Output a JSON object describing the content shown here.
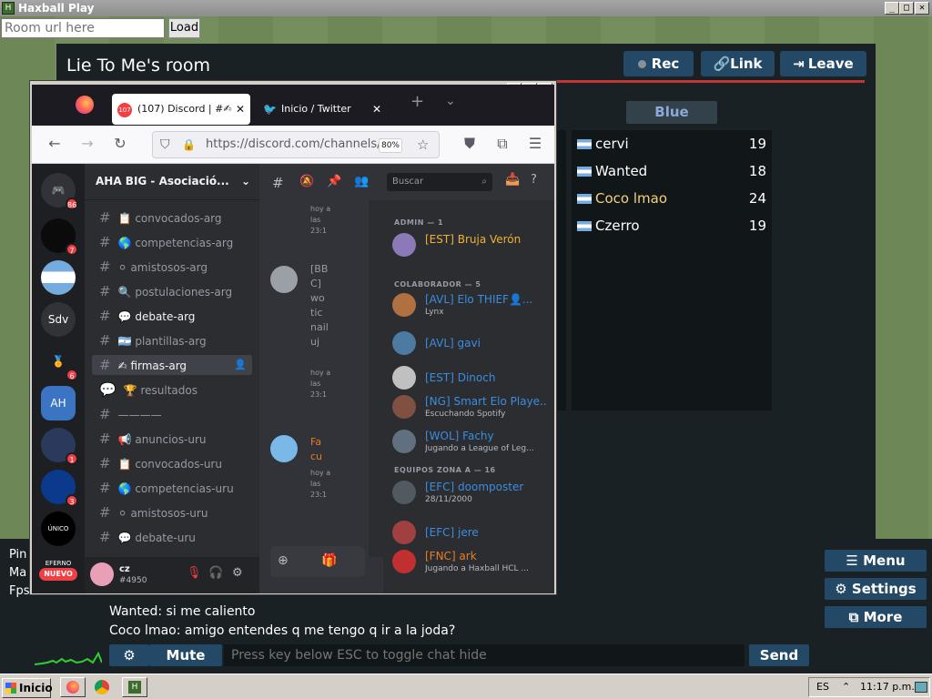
{
  "window": {
    "title": "Haxball Play",
    "icon": "H"
  },
  "toolbar": {
    "url_placeholder": "Room url here",
    "load_label": "Load"
  },
  "room": {
    "title": "Lie To Me's room",
    "rec_label": "Rec",
    "link_label": "Link",
    "leave_label": "Leave",
    "blue_team_label": "Blue",
    "blue_players": [
      {
        "name": "cervi",
        "score": "19",
        "flag": "argentina-flag"
      },
      {
        "name": "Wanted",
        "score": "18",
        "flag": "argentina-flag"
      },
      {
        "name": "Coco lmao",
        "score": "24",
        "flag": "argentina-flag",
        "highlight": "#f5d17e"
      },
      {
        "name": "Czerro",
        "score": "19",
        "flag": "argentina-flag"
      }
    ]
  },
  "stats": {
    "ping_label": "Pin",
    "max_label": "Ma",
    "fps_label": "Fps: 85"
  },
  "chat": {
    "lines": [
      "Wanted: si me caliento",
      "Coco lmao: amigo entendes q me tengo q ir a la joda?"
    ],
    "mute_label": "Mute",
    "input_placeholder": "Press key below ESC to toggle chat hide",
    "send_label": "Send"
  },
  "side_menu": {
    "menu_label": "Menu",
    "settings_label": "Settings",
    "more_label": "More"
  },
  "firefox": {
    "tabs": [
      {
        "label": "(107) Discord | #✍",
        "active": true,
        "badge": "107"
      },
      {
        "label": "Inicio / Twitter",
        "active": false
      }
    ],
    "url": "https://discord.com/channels/",
    "zoom": "80%"
  },
  "discord": {
    "guild_name": "AHA BIG - Asociació...",
    "servers": [
      {
        "label": "",
        "badge": "86"
      },
      {
        "label": "",
        "badge": "7"
      },
      {
        "label": "",
        "badge": ""
      },
      {
        "label": "Sdv",
        "badge": ""
      },
      {
        "label": "",
        "badge": "6"
      },
      {
        "label": "",
        "badge": ""
      },
      {
        "label": "",
        "badge": "1"
      },
      {
        "label": "",
        "badge": "3"
      },
      {
        "label": "ÚNICO EFERNO",
        "badge": ""
      },
      {
        "label": "",
        "badge": ""
      }
    ],
    "nuevo_label": "NUEVO",
    "channels": [
      {
        "label": "📋 convocados-arg"
      },
      {
        "label": "🌎 competencias-arg"
      },
      {
        "label": "⚪ amistosos-arg"
      },
      {
        "label": "🔍 postulaciones-arg"
      },
      {
        "label": "💬 debate-arg",
        "unread": true
      },
      {
        "label": "🇦🇷 plantillas-arg"
      },
      {
        "label": "✍ firmas-arg",
        "active": true
      },
      {
        "label": "🏆 resultados"
      },
      {
        "label": "————"
      },
      {
        "label": "📢 anuncios-uru"
      },
      {
        "label": "📋 convocados-uru"
      },
      {
        "label": "🌎 competencias-uru"
      },
      {
        "label": "⚪ amistosos-uru"
      },
      {
        "label": "💬 debate-uru"
      }
    ],
    "user": {
      "name": "cz",
      "tag": "#4950"
    },
    "search_placeholder": "Buscar",
    "messages": [
      {
        "text": "hoy a las 23:1"
      },
      {
        "text": "[BB C] wo tic nail uj",
        "time": "hoy a las 23:1"
      },
      {
        "text": "Fa cu",
        "time": "hoy a las 23:1"
      }
    ],
    "members": {
      "admin_header": "ADMIN — 1",
      "colab_header": "COLABORADOR — 5",
      "zona_header": "EQUIPOS ZONA A — 16",
      "list": [
        {
          "name": "[EST] Bruja Verón",
          "status": "",
          "color": "#f0b232"
        },
        {
          "name": "[AVL] Elo THIEF👤...",
          "status": "Lynx",
          "color": "#3b8de0"
        },
        {
          "name": "[AVL] gavi",
          "status": "",
          "color": "#3b8de0"
        },
        {
          "name": "[EST] Dinoch",
          "status": "",
          "color": "#3b8de0"
        },
        {
          "name": "[NG] Smart Elo Playe...",
          "status": "Escuchando Spotify",
          "color": "#3b8de0"
        },
        {
          "name": "[WOL] Fachy",
          "status": "Jugando a League of Leg...",
          "color": "#3b8de0"
        },
        {
          "name": "[EFC] doomposter",
          "status": "28/11/2000",
          "color": "#3b8de0"
        },
        {
          "name": "[EFC] jere",
          "status": "",
          "color": "#3b8de0"
        },
        {
          "name": "[FNC] ark",
          "status": "Jugando a Haxball HCL ...",
          "color": "#e67e22"
        }
      ]
    }
  },
  "taskbar": {
    "start_label": "Inicio",
    "lang": "ES",
    "clock": "11:17 p.m."
  }
}
